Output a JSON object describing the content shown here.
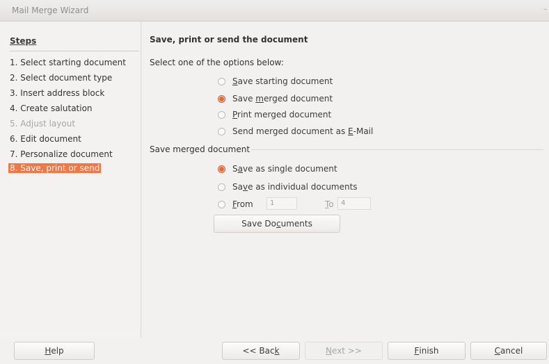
{
  "window": {
    "title": "Mail Merge Wizard"
  },
  "sidebar": {
    "heading": "Steps",
    "steps": [
      {
        "label": "1. Select starting document",
        "state": "normal"
      },
      {
        "label": "2. Select document type",
        "state": "normal"
      },
      {
        "label": "3. Insert address block",
        "state": "normal"
      },
      {
        "label": "4. Create salutation",
        "state": "normal"
      },
      {
        "label": "5. Adjust layout",
        "state": "disabled"
      },
      {
        "label": "6. Edit document",
        "state": "normal"
      },
      {
        "label": "7. Personalize document",
        "state": "normal"
      },
      {
        "label": "8. Save, print or send",
        "state": "current"
      }
    ]
  },
  "main": {
    "title": "Save, print or send the document",
    "options_label": "Select one of the options below:",
    "options": [
      {
        "pre": "",
        "key": "S",
        "post": "ave starting document",
        "checked": false
      },
      {
        "pre": "Save ",
        "key": "m",
        "post": "erged document",
        "checked": true
      },
      {
        "pre": "",
        "key": "P",
        "post": "rint merged document",
        "checked": false
      },
      {
        "pre": "Send merged document as ",
        "key": "E",
        "post": "-Mail",
        "checked": false
      }
    ],
    "save_section_label": "Save merged document",
    "save_options": [
      {
        "pre": "S",
        "key": "a",
        "post": "ve as single document",
        "checked": true
      },
      {
        "pre": "Sa",
        "key": "v",
        "post": "e as individual documents",
        "checked": false
      },
      {
        "pre": "",
        "key": "F",
        "post": "rom",
        "checked": false
      }
    ],
    "from_value": "1",
    "to_label_pre": "",
    "to_label_key": "T",
    "to_label_post": "o",
    "to_value": "4",
    "save_button": {
      "pre": "Save Do",
      "key": "c",
      "post": "uments"
    }
  },
  "footer": {
    "help": {
      "pre": "",
      "key": "H",
      "post": "elp"
    },
    "back": {
      "pre": "<< Bac",
      "key": "k",
      "post": ""
    },
    "next": {
      "pre": "",
      "key": "N",
      "post": "ext >>"
    },
    "finish": {
      "pre": "",
      "key": "F",
      "post": "inish"
    },
    "cancel": {
      "pre": "",
      "key": "C",
      "post": "ancel"
    }
  },
  "colors": {
    "accent": "#f07746",
    "radio_checked": "#e4663a"
  }
}
